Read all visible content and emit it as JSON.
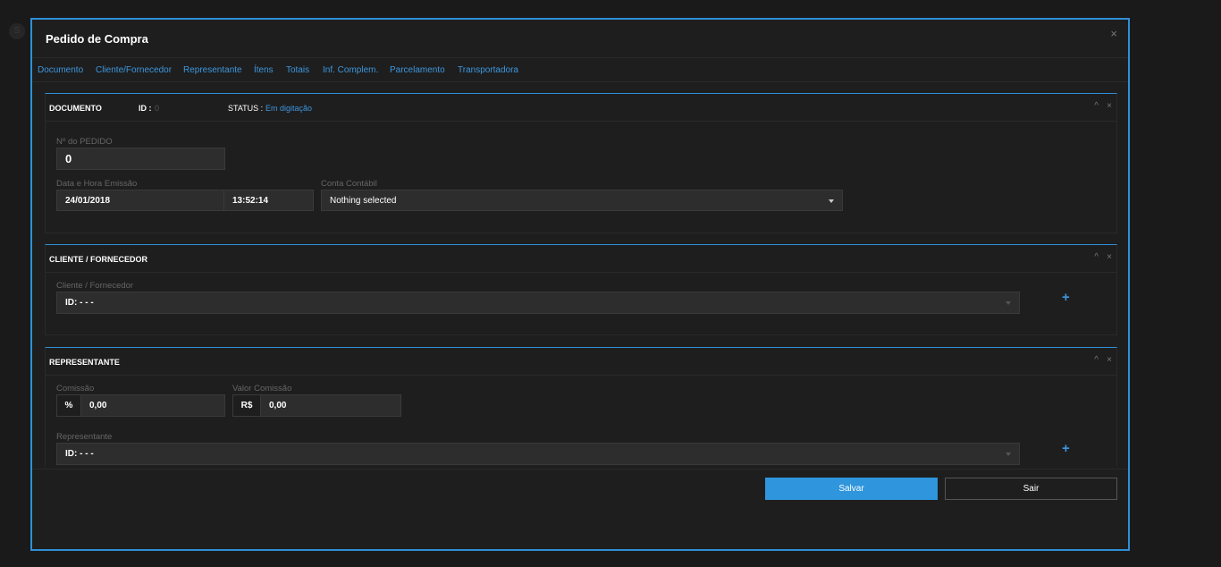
{
  "modal": {
    "title": "Pedido de Compra",
    "close": "×"
  },
  "tabs": [
    "Documento",
    "Cliente/Fornecedor",
    "Representante",
    "Ítens",
    "Totais",
    "Inf. Complem.",
    "Parcelamento",
    "Transportadora"
  ],
  "documento": {
    "title": "DOCUMENTO",
    "id_label": "ID :",
    "id_value": "0",
    "status_label": "STATUS :",
    "status_value": "Em digitação",
    "pedido_label": "Nº do PEDIDO",
    "pedido_value": "0",
    "data_label": "Data e Hora Emissão",
    "data_value": "24/01/2018",
    "hora_value": "13:52:14",
    "conta_label": "Conta Contábil",
    "conta_value": "Nothing selected"
  },
  "cliente": {
    "title": "CLIENTE / FORNECEDOR",
    "field_label": "Cliente / Fornecedor",
    "field_value": "ID: - - -",
    "add": "+"
  },
  "representante": {
    "title": "REPRESENTANTE",
    "comissao_label": "Comissão",
    "comissao_addon": "%",
    "comissao_value": "0,00",
    "valor_label": "Valor Comissão",
    "valor_addon": "R$",
    "valor_value": "0,00",
    "rep_label": "Representante",
    "rep_value": "ID: - - -",
    "add": "+"
  },
  "panel_controls": {
    "collapse": "^",
    "close": "×"
  },
  "footer": {
    "save": "Salvar",
    "exit": "Sair"
  },
  "accent_color": "#2f8fd8"
}
